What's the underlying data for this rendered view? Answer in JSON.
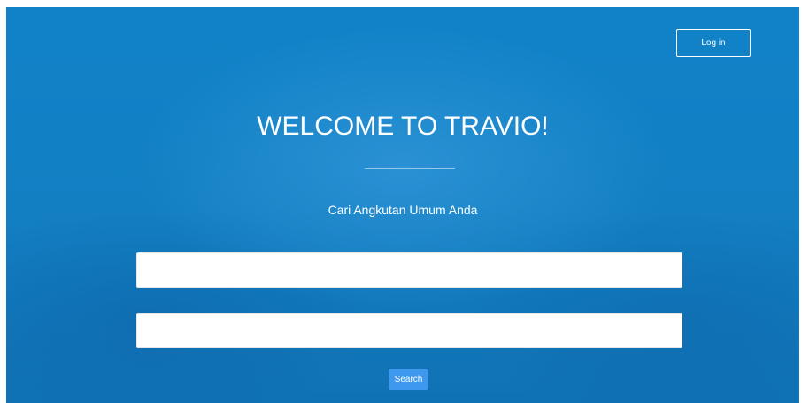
{
  "header": {
    "login_label": "Log in"
  },
  "hero": {
    "title": "WELCOME TO TRAVIO!",
    "subtitle": "Cari Angkutan Umum Anda"
  },
  "search": {
    "from_value": "",
    "to_value": "",
    "button_label": "Search"
  },
  "colors": {
    "background": "#137fc3",
    "search_button": "#3e98ee",
    "text": "#ffffff"
  }
}
